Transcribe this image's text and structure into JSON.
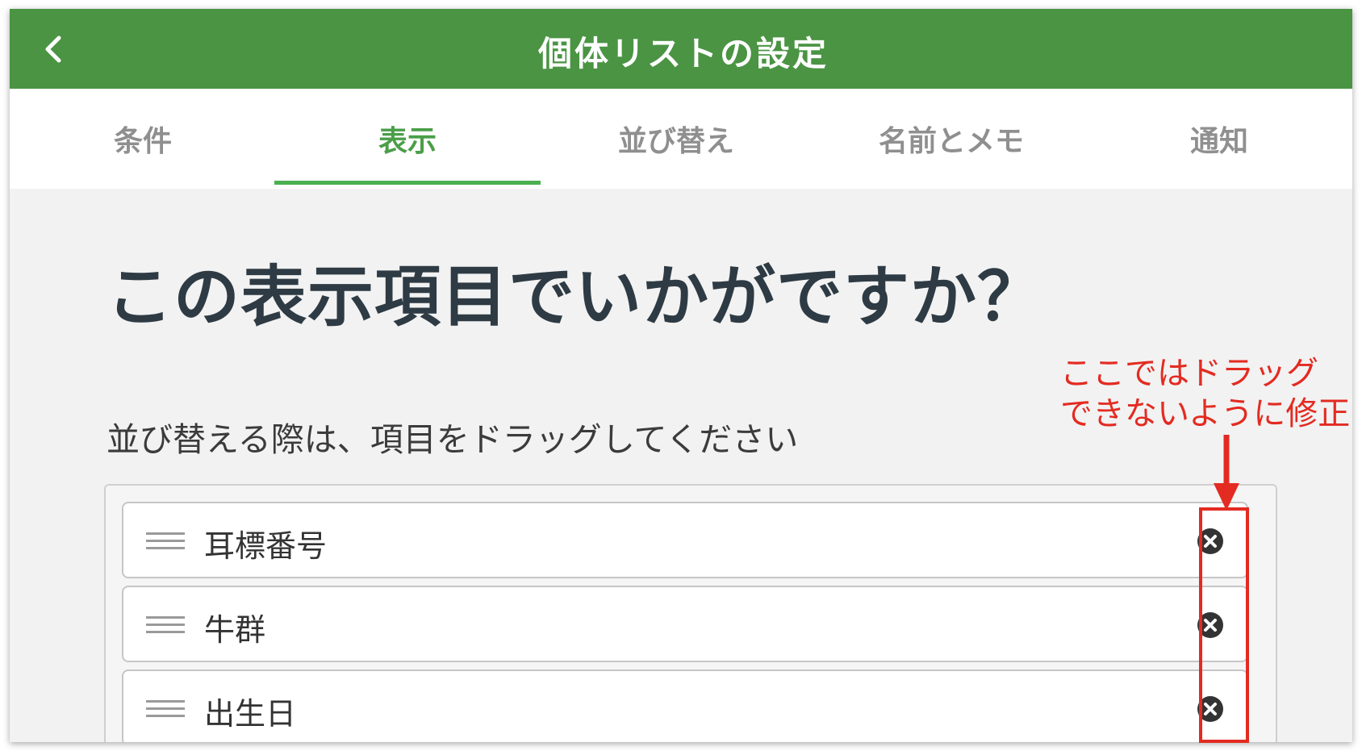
{
  "header": {
    "title": "個体リストの設定",
    "back_icon": "chevron-left-icon",
    "color": "#4a9443"
  },
  "tabs": [
    {
      "label": "条件",
      "active": false
    },
    {
      "label": "表示",
      "active": true
    },
    {
      "label": "並び替え",
      "active": false
    },
    {
      "label": "名前とメモ",
      "active": false
    },
    {
      "label": "通知",
      "active": false
    }
  ],
  "content": {
    "heading": "この表示項目でいかがですか？",
    "subtext": "並び替える際は、項目をドラッグしてください",
    "items": [
      {
        "label": "耳標番号"
      },
      {
        "label": "牛群"
      },
      {
        "label": "出生日"
      }
    ]
  },
  "annotation": {
    "line1": "ここではドラッグ",
    "line2": "できないように修正",
    "color": "#e32b21"
  }
}
